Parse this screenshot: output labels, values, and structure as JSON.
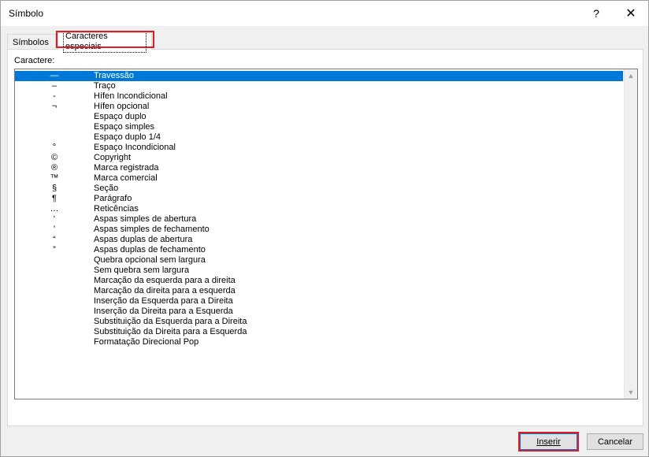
{
  "window": {
    "title": "Símbolo",
    "help_label": "?",
    "close_label": "✕"
  },
  "tabs": [
    {
      "label": "Símbolos"
    },
    {
      "label": "Caracteres especiais"
    }
  ],
  "list": {
    "label": "Caractere:",
    "items": [
      {
        "symbol": "—",
        "name": "Travessão"
      },
      {
        "symbol": "–",
        "name": "Traço"
      },
      {
        "symbol": "-",
        "name": "Hífen Incondicional"
      },
      {
        "symbol": "¬",
        "name": "Hífen opcional"
      },
      {
        "symbol": "",
        "name": "Espaço duplo"
      },
      {
        "symbol": "",
        "name": "Espaço simples"
      },
      {
        "symbol": "",
        "name": "Espaço duplo 1/4"
      },
      {
        "symbol": "°",
        "name": "Espaço Incondicional"
      },
      {
        "symbol": "©",
        "name": "Copyright"
      },
      {
        "symbol": "®",
        "name": "Marca registrada"
      },
      {
        "symbol": "™",
        "name": "Marca comercial"
      },
      {
        "symbol": "§",
        "name": "Seção"
      },
      {
        "symbol": "¶",
        "name": "Parágrafo"
      },
      {
        "symbol": "…",
        "name": "Reticências"
      },
      {
        "symbol": "‘",
        "name": "Aspas simples de abertura"
      },
      {
        "symbol": "’",
        "name": "Aspas simples de fechamento"
      },
      {
        "symbol": "“",
        "name": "Aspas duplas de abertura"
      },
      {
        "symbol": "”",
        "name": "Aspas duplas de fechamento"
      },
      {
        "symbol": "",
        "name": "Quebra opcional sem largura"
      },
      {
        "symbol": "",
        "name": "Sem quebra sem largura"
      },
      {
        "symbol": "",
        "name": "Marcação da esquerda para a direita"
      },
      {
        "symbol": "",
        "name": "Marcação da direita para a esquerda"
      },
      {
        "symbol": "",
        "name": "Inserção da Esquerda para a Direita"
      },
      {
        "symbol": "",
        "name": "Inserção da Direita para a Esquerda"
      },
      {
        "symbol": "",
        "name": "Substituição da Esquerda para a Direita"
      },
      {
        "symbol": "",
        "name": "Substituição da Direita para a Esquerda"
      },
      {
        "symbol": "",
        "name": "Formatação Direcional Pop"
      }
    ]
  },
  "buttons": {
    "insert_label": "Inserir",
    "cancel_label": "Cancelar"
  },
  "colors": {
    "selection": "#0078d7",
    "highlight_outline": "#e01b24"
  }
}
